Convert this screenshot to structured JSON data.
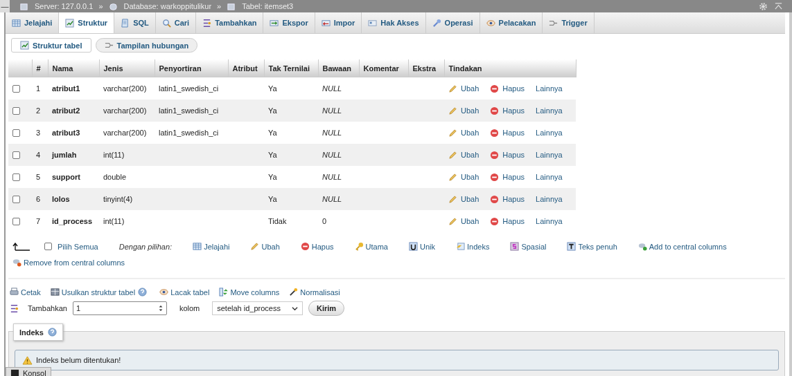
{
  "breadcrumb": {
    "collapse": "—",
    "items": [
      {
        "label": "Server: 127.0.0.1"
      },
      {
        "label": "Database: warkoppitulikur"
      },
      {
        "label": "Tabel: itemset3"
      }
    ],
    "separator": "»"
  },
  "tabs": [
    {
      "label": "Jelajahi",
      "selected": false
    },
    {
      "label": "Struktur",
      "selected": true
    },
    {
      "label": "SQL",
      "selected": false
    },
    {
      "label": "Cari",
      "selected": false
    },
    {
      "label": "Tambahkan",
      "selected": false
    },
    {
      "label": "Ekspor",
      "selected": false
    },
    {
      "label": "Impor",
      "selected": false
    },
    {
      "label": "Hak Akses",
      "selected": false
    },
    {
      "label": "Operasi",
      "selected": false
    },
    {
      "label": "Pelacakan",
      "selected": false
    },
    {
      "label": "Trigger",
      "selected": false
    }
  ],
  "subnav": [
    {
      "label": "Struktur tabel",
      "selected": true
    },
    {
      "label": "Tampilan hubungan",
      "selected": false
    }
  ],
  "table": {
    "columns": [
      "#",
      "Nama",
      "Jenis",
      "Penyortiran",
      "Atribut",
      "Tak Ternilai",
      "Bawaan",
      "Komentar",
      "Ekstra",
      "Tindakan"
    ],
    "rows": [
      {
        "checked": false,
        "number": "1",
        "name": "atribut1",
        "type": "varchar(200)",
        "collation": "latin1_swedish_ci",
        "null": "Ya",
        "default": "NULL",
        "default_null": true,
        "actions": [
          "Ubah",
          "Hapus",
          "Lainnya"
        ]
      },
      {
        "checked": false,
        "number": "2",
        "name": "atribut2",
        "type": "varchar(200)",
        "collation": "latin1_swedish_ci",
        "null": "Ya",
        "default": "NULL",
        "default_null": true,
        "actions": [
          "Ubah",
          "Hapus",
          "Lainnya"
        ]
      },
      {
        "checked": false,
        "number": "3",
        "name": "atribut3",
        "type": "varchar(200)",
        "collation": "latin1_swedish_ci",
        "null": "Ya",
        "default": "NULL",
        "default_null": true,
        "actions": [
          "Ubah",
          "Hapus",
          "Lainnya"
        ]
      },
      {
        "checked": false,
        "number": "4",
        "name": "jumlah",
        "type": "int(11)",
        "collation": "",
        "null": "Ya",
        "default": "NULL",
        "default_null": true,
        "actions": [
          "Ubah",
          "Hapus",
          "Lainnya"
        ]
      },
      {
        "checked": false,
        "number": "5",
        "name": "support",
        "type": "double",
        "collation": "",
        "null": "Ya",
        "default": "NULL",
        "default_null": true,
        "actions": [
          "Ubah",
          "Hapus",
          "Lainnya"
        ]
      },
      {
        "checked": false,
        "number": "6",
        "name": "lolos",
        "type": "tinyint(4)",
        "collation": "",
        "null": "Ya",
        "default": "NULL",
        "default_null": true,
        "actions": [
          "Ubah",
          "Hapus",
          "Lainnya"
        ]
      },
      {
        "checked": false,
        "number": "7",
        "name": "id_process",
        "type": "int(11)",
        "collation": "",
        "null": "Tidak",
        "default": "0",
        "default_null": false,
        "actions": [
          "Ubah",
          "Hapus",
          "Lainnya"
        ]
      }
    ]
  },
  "bulk": {
    "select_all": {
      "label": "Pilih Semua",
      "checked": false
    },
    "with_selected": "Dengan pilihan:",
    "actions": [
      "Jelajahi",
      "Ubah",
      "Hapus",
      "Utama",
      "Unik",
      "Indeks",
      "Spasial",
      "Teks penuh",
      "Add to central columns",
      "Remove from central columns"
    ]
  },
  "toolbar": {
    "links": [
      "Cetak",
      "Usulkan struktur tabel",
      "Lacak tabel",
      "Move columns",
      "Normalisasi"
    ],
    "add_label": "Tambahkan",
    "add_count": "1",
    "unit": "kolom",
    "position": "setelah id_process",
    "submit": "Kirim"
  },
  "indexes": {
    "legend": "Indeks",
    "message": "Indeks belum ditentukan!"
  },
  "console": {
    "label": "Konsol"
  }
}
